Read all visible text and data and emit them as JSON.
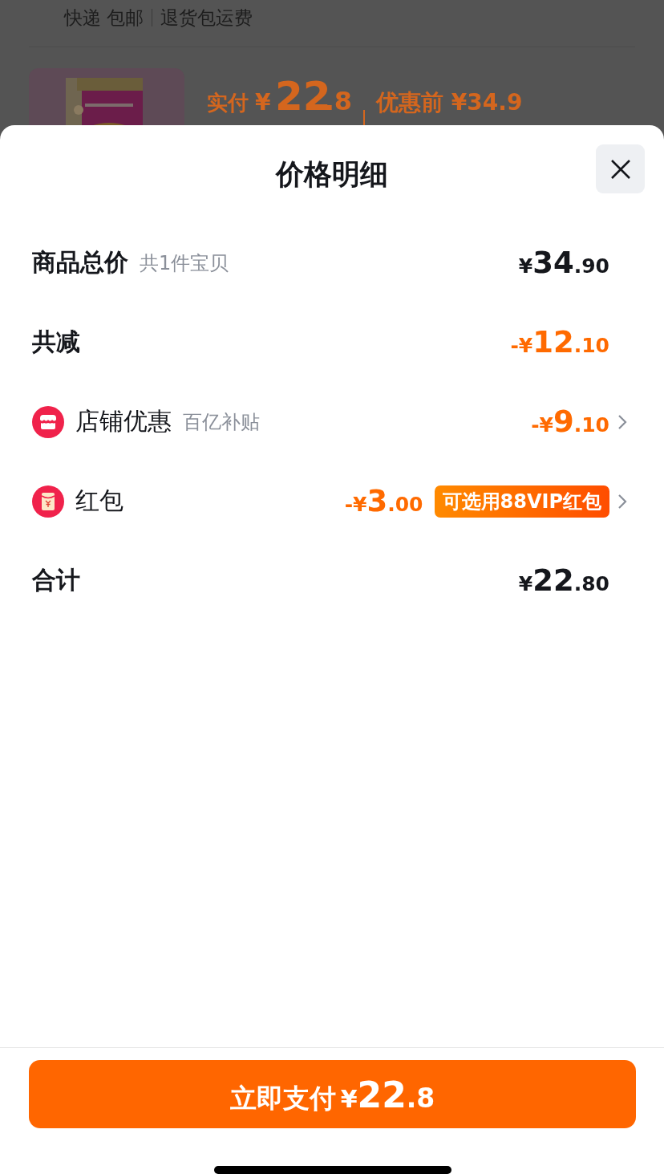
{
  "background_page": {
    "shipping": "快递 包邮",
    "returns": "退货包运费",
    "paid_label": "实付",
    "paid_price": {
      "currency": "¥",
      "integer": "22",
      "decimal": ".8"
    },
    "original_label": "优惠前",
    "original_price": "¥34.9"
  },
  "sheet": {
    "title": "价格明细",
    "rows": [
      {
        "kind": "subtotal",
        "label": "商品总价",
        "note": "共1件宝贝",
        "amount": {
          "prefix": "¥",
          "integer": "34",
          "decimal": ".90"
        }
      },
      {
        "kind": "reduction",
        "label": "共减",
        "amount": {
          "prefix": "-¥",
          "integer": "12",
          "decimal": ".10"
        }
      },
      {
        "kind": "shop",
        "label": "店铺优惠",
        "note": "百亿补贴",
        "amount": {
          "prefix": "-¥",
          "integer": "9",
          "decimal": ".10"
        }
      },
      {
        "kind": "packet",
        "label": "红包",
        "amount": {
          "prefix": "-¥",
          "integer": "3",
          "decimal": ".00"
        },
        "badge": "可选用88VIP红包"
      },
      {
        "kind": "total",
        "label": "合计",
        "amount": {
          "prefix": "¥",
          "integer": "22",
          "decimal": ".80"
        }
      }
    ],
    "pay_button": {
      "label": "立即支付",
      "currency": "¥",
      "integer": "22",
      "decimal": ".8"
    }
  }
}
